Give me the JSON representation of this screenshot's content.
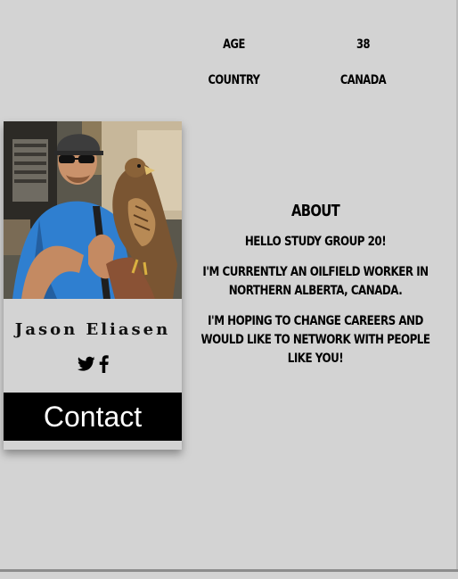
{
  "stats": [
    {
      "label": "AGE",
      "value": "38"
    },
    {
      "label": "COUNTRY",
      "value": "CANADA"
    }
  ],
  "profile": {
    "name": "Jason Eliasen",
    "contact_label": "Contact",
    "social_icons": [
      "twitter-icon",
      "facebook-icon"
    ]
  },
  "about": {
    "title": "ABOUT",
    "paragraphs": [
      "HELLO STUDY GROUP 20!",
      "I'M CURRENTLY AN OILFIELD WORKER IN NORTHERN ALBERTA, CANADA.",
      "I'M HOPING TO CHANGE CAREERS AND WOULD LIKE TO NETWORK WITH PEOPLE LIKE YOU!"
    ]
  },
  "colors": {
    "background": "#d3d3d3",
    "contact_bg": "#000000",
    "contact_text": "#ffffff"
  }
}
